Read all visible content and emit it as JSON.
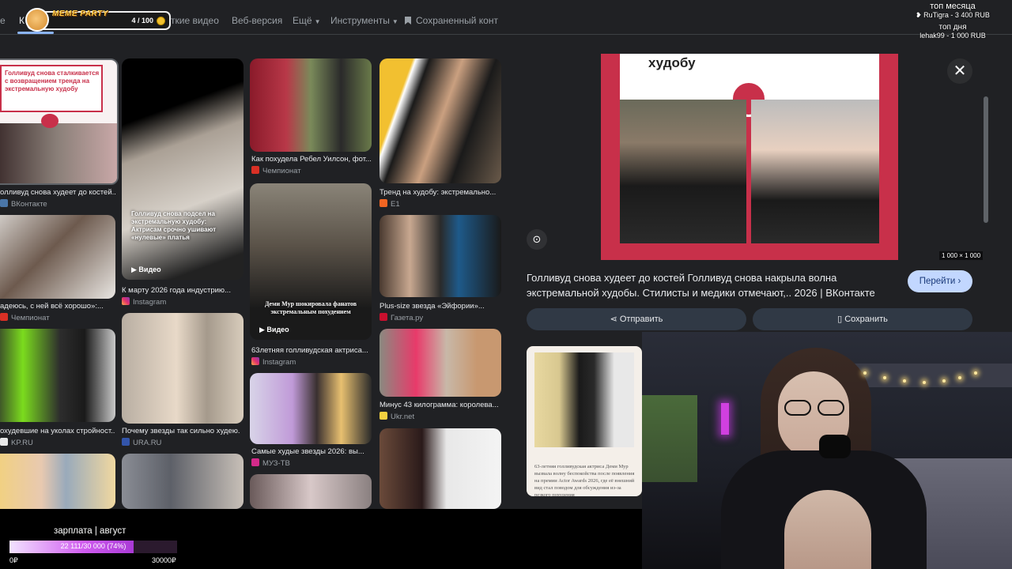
{
  "nav": {
    "tabs": [
      {
        "label": "е"
      },
      {
        "label": "К"
      },
      {
        "label": "ткие видео"
      },
      {
        "label": "Веб-версия"
      },
      {
        "label": "Ещё"
      },
      {
        "label": "Инструменты"
      },
      {
        "label": "Сохраненный конт"
      }
    ]
  },
  "overlay": {
    "meme_title": "MEME PARTY",
    "meme_count": "4 / 100",
    "top_month_label": "топ месяца",
    "top_month_value": "RuTigra - 3 400 RUB",
    "top_day_label": "топ дня",
    "top_day_value": "lehak99 - 1 000 RUB"
  },
  "grid": {
    "col1": [
      {
        "caption": "олливуд снова худеет до костей...",
        "source": "ВКонтакте",
        "thumb_text": "Голливуд снова сталкивается с возвращением тренда на экстремальную худобу"
      },
      {
        "caption": "адеюсь, с ней всё хорошо»:...",
        "source": "Чемпионат"
      },
      {
        "caption": "охудевшие на уколах стройност...",
        "source": "KP.RU"
      },
      {
        "caption": "",
        "source": ""
      }
    ],
    "col2": [
      {
        "caption": "К марту 2026 года индустрию...",
        "source": "Instagram",
        "video": "Видео",
        "thumb_text": "Голливуд снова подсел на экстремальную худобу: Актрисам срочно ушивают «нулевые» платья"
      },
      {
        "caption": "Почему звезды так сильно худею...",
        "source": "URA.RU"
      },
      {
        "caption": "",
        "source": ""
      }
    ],
    "col3": [
      {
        "caption": "Как похудела Ребел Уилсон, фот...",
        "source": "Чемпионат"
      },
      {
        "caption": "63летняя голливудская актриса...",
        "source": "Instagram",
        "video": "Видео",
        "thumb_text": "Деми Мур шокировала фанатов экстремальным похудением"
      },
      {
        "caption": "Самые худые звезды 2026: вы...",
        "source": "МУЗ-ТВ"
      },
      {
        "caption": "",
        "source": ""
      }
    ],
    "col4": [
      {
        "caption": "Тренд на худобу: экстремально...",
        "source": "E1"
      },
      {
        "caption": "Plus-size звезда «Эйфории»...",
        "source": "Газета.ру"
      },
      {
        "caption": "Минус 43 килограмма: королева...",
        "source": "Ukr.net"
      },
      {
        "caption": "",
        "source": ""
      }
    ]
  },
  "preview": {
    "image_headline": "худобу",
    "dimensions": "1 000 × 1 000",
    "title": "Голливуд снова худеет до костей Голливуд снова накрыла волна экстремальной худобы. Стилисты и медики отмечают,.. 2026 | ВКонтакте",
    "go_label": "Перейти",
    "share_label": "Отправить",
    "save_label": "Сохранить",
    "related_text": "63-летняя голливудская актриса Деми Мур вызвала волну беспокойства после появления на премии Actor Awards 2026, где её внешний вид стал поводом для обсуждения из-за резкого похудения"
  },
  "salary": {
    "title": "зарплата | август",
    "value_text": "22 111/30 000 (74%)",
    "progress": 0.74,
    "min_label": "0₽",
    "max_label": "30000₽"
  },
  "colors": {
    "accent": "#8ab4f8",
    "go_button": "#c2d7ff",
    "panel_red": "#c8304a"
  }
}
